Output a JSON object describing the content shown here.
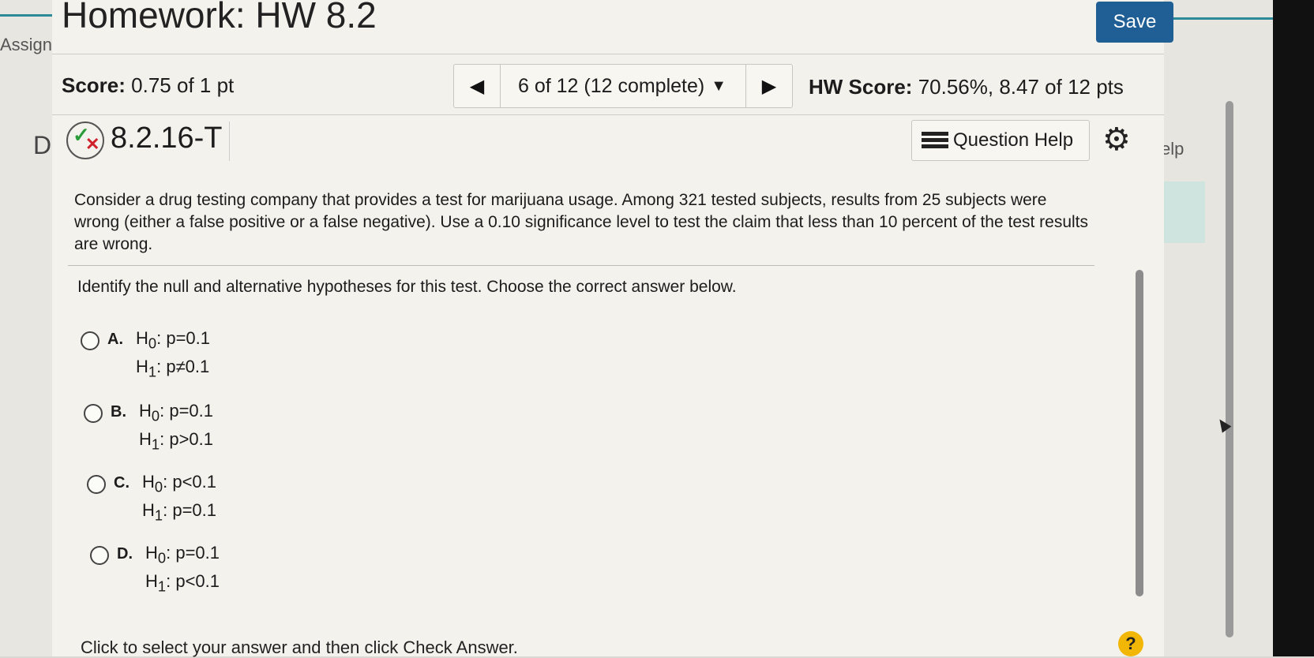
{
  "background": {
    "left_tab_text": "Assign",
    "left_letter": "D",
    "right_help_fragment": "elp"
  },
  "header": {
    "title": "Homework: HW 8.2",
    "save_label": "Save"
  },
  "score_bar": {
    "score_label": "Score:",
    "score_value": "0.75 of 1 pt",
    "nav_status": "6 of 12 (12 complete)",
    "hw_score_label": "HW Score:",
    "hw_score_value": "70.56%, 8.47 of 12 pts"
  },
  "question_header": {
    "number": "8.2.16-T",
    "help_label": "Question Help",
    "status": "partially-correct"
  },
  "question": {
    "text": "Consider a drug testing company that provides a test for marijuana usage. Among 321 tested subjects, results from 25 subjects were wrong (either a false positive or a false negative). Use a 0.10 significance level to test the claim that less than 10 percent of the test results are wrong.",
    "instruction": "Identify the null and alternative hypotheses for this test. Choose the correct answer below.",
    "options": [
      {
        "letter": "A.",
        "h0_rel": "p=0.1",
        "h1_rel": "p≠0.1"
      },
      {
        "letter": "B.",
        "h0_rel": "p=0.1",
        "h1_rel": "p>0.1"
      },
      {
        "letter": "C.",
        "h0_rel": "p<0.1",
        "h1_rel": "p=0.1"
      },
      {
        "letter": "D.",
        "h0_rel": "p=0.1",
        "h1_rel": "p<0.1"
      }
    ]
  },
  "footer": {
    "hint": "Click to select your answer and then click Check Answer.",
    "help_glyph": "?"
  },
  "icons": [
    "prev-arrow-icon",
    "next-arrow-icon",
    "dropdown-caret-icon",
    "list-icon",
    "gear-icon",
    "check-x-status-icon",
    "help-circle-icon"
  ]
}
